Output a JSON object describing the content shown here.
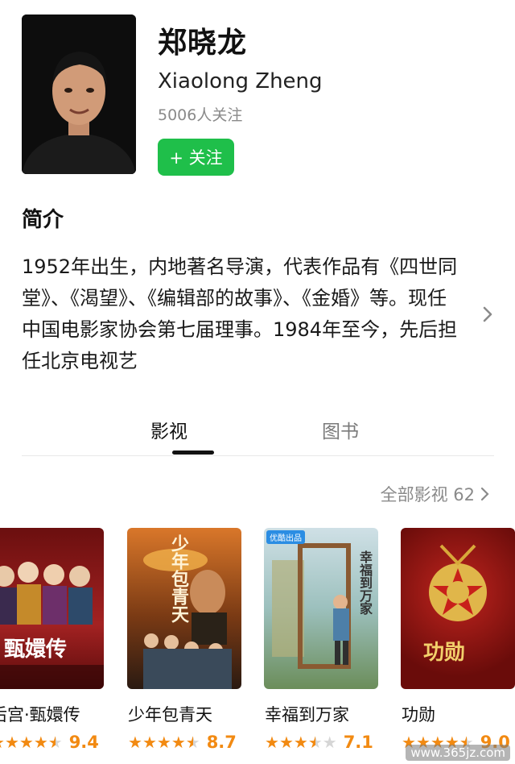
{
  "profile": {
    "name_cn": "郑晓龙",
    "name_en": "Xiaolong Zheng",
    "followers": "5006人关注",
    "follow_label": "+ 关注"
  },
  "intro": {
    "title": "简介",
    "text": "1952年出生，内地著名导演，代表作品有《四世同堂》、《渴望》、《编辑部的故事》、《金婚》等。现任中国电影家协会第七届理事。1984年至今，先后担任北京电视艺"
  },
  "tabs": [
    {
      "label": "影视",
      "active": true
    },
    {
      "label": "图书",
      "active": false
    }
  ],
  "all_films": "全部影视 62",
  "films": [
    {
      "title": "后宫·甄嬛传",
      "rating": 9.4,
      "score": "9.4",
      "stars": 4.5,
      "poster_text": "甄嬛传",
      "accent": "#8b1a1a"
    },
    {
      "title": "少年包青天",
      "rating": 8.7,
      "score": "8.7",
      "stars": 4.5,
      "poster_text": "少年包青天",
      "accent": "#a8561c"
    },
    {
      "title": "幸福到万家",
      "rating": 7.1,
      "score": "7.1",
      "stars": 3.5,
      "poster_text": "幸福到万家",
      "badge": "优酷出品",
      "accent": "#7aa6a2"
    },
    {
      "title": "功勋",
      "rating": 9.0,
      "score": "9.0",
      "stars": 4.5,
      "poster_text": "功勋",
      "accent": "#8e1412"
    }
  ],
  "watermark": "www.365jz.com",
  "colors": {
    "follow_green": "#1fbf4a",
    "star_orange": "#f28a12",
    "star_gray": "#d6d6d6"
  }
}
